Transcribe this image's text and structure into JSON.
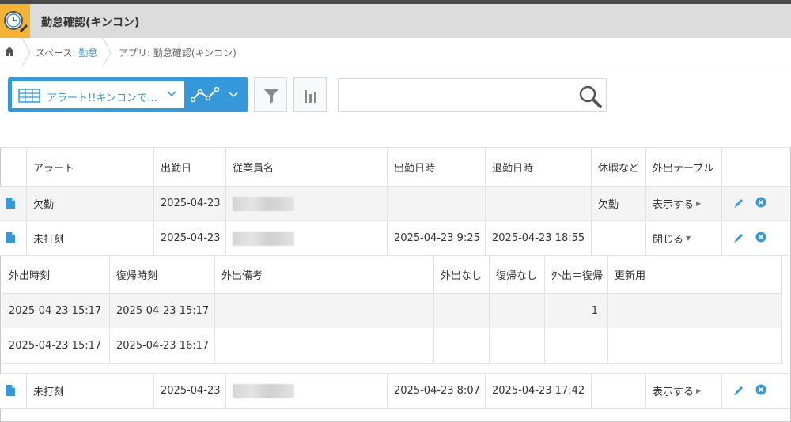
{
  "app": {
    "title": "勤怠確認(キンコン)"
  },
  "breadcrumb": {
    "space_prefix": "スペース: ",
    "space_name": "勤怠",
    "app_label": "アプリ: 勤怠確認(キンコン)"
  },
  "toolbar": {
    "view_label": "アラート!!キンコンで…",
    "search_value": ""
  },
  "table": {
    "columns": [
      "アラート",
      "出勤日",
      "従業員名",
      "出勤日時",
      "退勤日時",
      "休暇など",
      "外出テーブル"
    ],
    "rows": [
      {
        "alert": "欠勤",
        "date": "2025-04-23",
        "employee": "",
        "clock_in": "",
        "clock_out": "",
        "leave": "欠勤",
        "toggle": "表示する"
      },
      {
        "alert": "未打刻",
        "date": "2025-04-23",
        "employee": "",
        "clock_in": "2025-04-23 9:25",
        "clock_out": "2025-04-23 18:55",
        "leave": "",
        "toggle": "閉じる"
      },
      {
        "alert": "未打刻",
        "date": "2025-04-23",
        "employee": "",
        "clock_in": "2025-04-23 8:07",
        "clock_out": "2025-04-23 17:42",
        "leave": "",
        "toggle": "表示する"
      }
    ]
  },
  "subtable": {
    "columns": [
      "外出時刻",
      "復帰時刻",
      "外出備考",
      "外出なし",
      "復帰なし",
      "外出＝復帰",
      "更新用"
    ],
    "rows": [
      {
        "out": "2025-04-23 15:17",
        "back": "2025-04-23 15:17",
        "note": "",
        "no_out": "",
        "no_back": "",
        "same": "1",
        "update": ""
      },
      {
        "out": "2025-04-23 15:17",
        "back": "2025-04-23 16:17",
        "note": "",
        "no_out": "",
        "no_back": "",
        "same": "",
        "update": ""
      }
    ]
  },
  "colors": {
    "accent": "#3498db",
    "header_bar": "#dcdcdc",
    "icon_bg": "#f5b335",
    "row_alt": "#f4f4f4"
  }
}
